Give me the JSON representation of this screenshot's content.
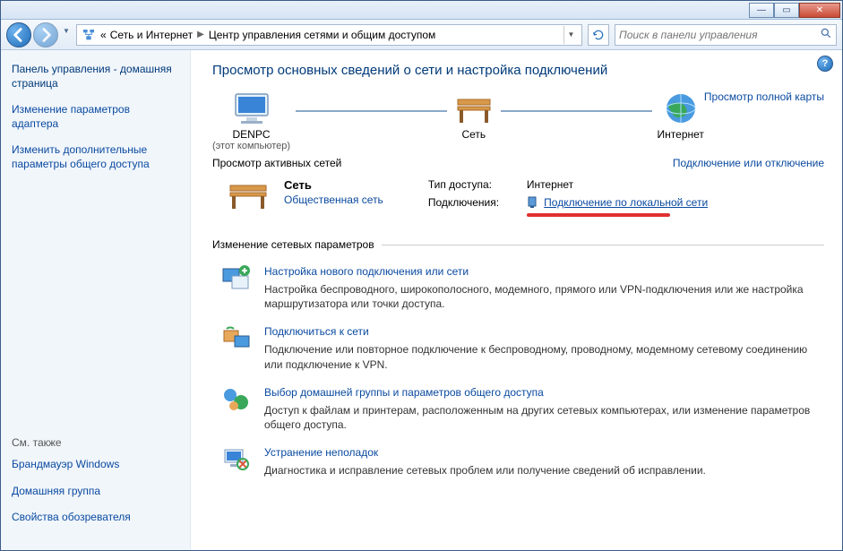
{
  "titlebar": {
    "min": "—",
    "max": "▭",
    "close": "✕"
  },
  "nav": {
    "breadcrumb_prefix": "«",
    "crumb1": "Сеть и Интернет",
    "crumb2": "Центр управления сетями и общим доступом",
    "search_placeholder": "Поиск в панели управления"
  },
  "sidebar": {
    "home": "Панель управления - домашняя страница",
    "link1": "Изменение параметров адаптера",
    "link2": "Изменить дополнительные параметры общего доступа",
    "seealso": "См. также",
    "sa1": "Брандмауэр Windows",
    "sa2": "Домашняя группа",
    "sa3": "Свойства обозревателя"
  },
  "main": {
    "title": "Просмотр основных сведений о сети и настройка подключений",
    "fullmap": "Просмотр полной карты",
    "node_pc": "DENPC",
    "node_pc_sub": "(этот компьютер)",
    "node_net": "Сеть",
    "node_inet": "Интернет",
    "active_nets": "Просмотр активных сетей",
    "conn_disc": "Подключение или отключение",
    "net_name": "Сеть",
    "net_type": "Общественная сеть",
    "access_lbl": "Тип доступа:",
    "access_val": "Интернет",
    "conns_lbl": "Подключения:",
    "conn_link": "Подключение по локальной сети",
    "params_legend": "Изменение сетевых параметров",
    "t1_title": "Настройка нового подключения или сети",
    "t1_desc": "Настройка беспроводного, широкополосного, модемного, прямого или VPN-подключения или же настройка маршрутизатора или точки доступа.",
    "t2_title": "Подключиться к сети",
    "t2_desc": "Подключение или повторное подключение к беспроводному, проводному, модемному сетевому соединению или подключение к VPN.",
    "t3_title": "Выбор домашней группы и параметров общего доступа",
    "t3_desc": "Доступ к файлам и принтерам, расположенным на других сетевых компьютерах, или изменение параметров общего доступа.",
    "t4_title": "Устранение неполадок",
    "t4_desc": "Диагностика и исправление сетевых проблем или получение сведений об исправлении."
  }
}
